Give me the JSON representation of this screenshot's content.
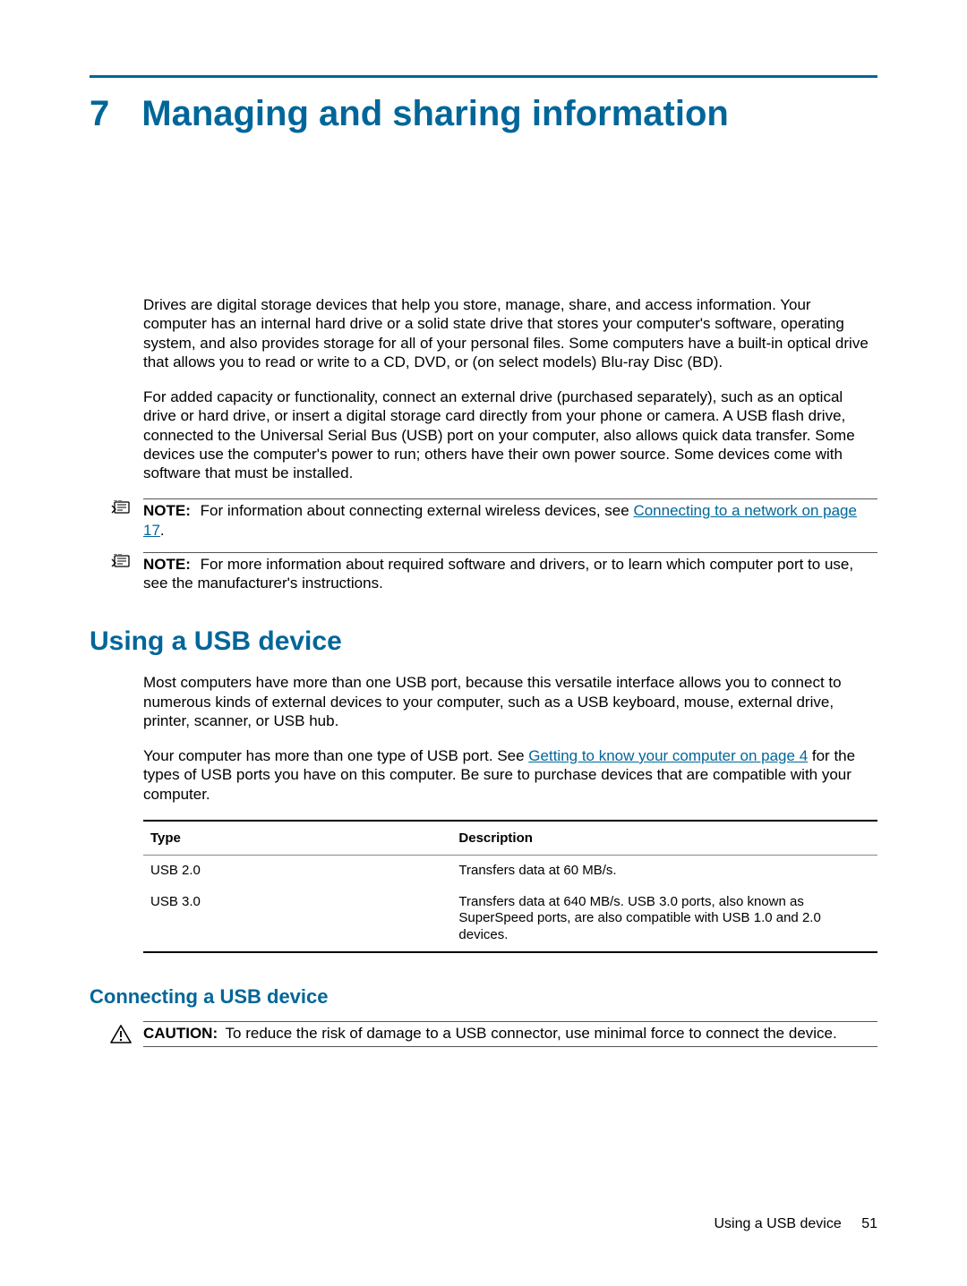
{
  "chapter": {
    "number": "7",
    "title": "Managing and sharing information"
  },
  "intro": {
    "p1": "Drives are digital storage devices that help you store, manage, share, and access information. Your computer has an internal hard drive or a solid state drive that stores your computer's software, operating system, and also provides storage for all of your personal files. Some computers have a built-in optical drive that allows you to read or write to a CD, DVD, or (on select models) Blu-ray Disc (BD).",
    "p2": "For added capacity or functionality, connect an external drive (purchased separately), such as an optical drive or hard drive, or insert a digital storage card directly from your phone or camera. A USB flash drive, connected to the Universal Serial Bus (USB) port on your computer, also allows quick data transfer. Some devices use the computer's power to run; others have their own power source. Some devices come with software that must be installed."
  },
  "notes": {
    "label": "NOTE:",
    "n1_pre": "For information about connecting external wireless devices, see ",
    "n1_link": "Connecting to a network on page 17",
    "n1_post": ".",
    "n2": "For more information about required software and drivers, or to learn which computer port to use, see the manufacturer's instructions."
  },
  "usb_section": {
    "heading": "Using a USB device",
    "p1": "Most computers have more than one USB port, because this versatile interface allows you to connect to numerous kinds of external devices to your computer, such as a USB keyboard, mouse, external drive, printer, scanner, or USB hub.",
    "p2_pre": "Your computer has more than one type of USB port. See ",
    "p2_link": "Getting to know your computer on page 4",
    "p2_post": " for the types of USB ports you have on this computer. Be sure to purchase devices that are compatible with your computer.",
    "table": {
      "headers": {
        "type": "Type",
        "desc": "Description"
      },
      "rows": [
        {
          "type": "USB 2.0",
          "desc": "Transfers data at 60 MB/s."
        },
        {
          "type": "USB 3.0",
          "desc": "Transfers data at 640 MB/s. USB 3.0 ports, also known as SuperSpeed ports, are also compatible with USB 1.0 and 2.0 devices."
        }
      ]
    }
  },
  "connect_section": {
    "heading": "Connecting a USB device",
    "caution_label": "CAUTION:",
    "caution_text": "To reduce the risk of damage to a USB connector, use minimal force to connect the device."
  },
  "footer": {
    "text": "Using a USB device",
    "page": "51"
  }
}
